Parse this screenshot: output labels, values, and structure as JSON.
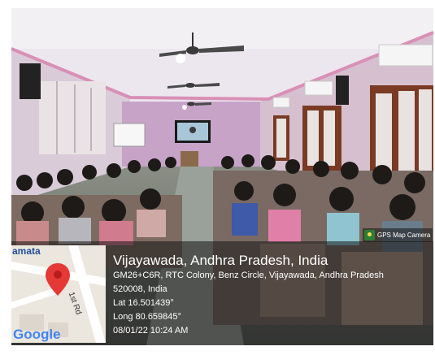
{
  "photo": {
    "description_icon": "classroom-photo"
  },
  "camera_badge": {
    "label": "GPS Map Camera",
    "icon": "gps-map-camera-icon"
  },
  "map": {
    "place_label": "amata",
    "road_label": "1st Rd",
    "brand": "Google",
    "pin_icon": "map-pin-icon"
  },
  "location": {
    "title": "Vijayawada, Andhra Pradesh, India",
    "address_line1": "GM26+C6R, RTC Colony, Benz Circle, Vijayawada, Andhra Pradesh",
    "address_line2": "520008, India",
    "lat": "Lat 16.501439°",
    "long": "Long 80.659845°",
    "datetime": "08/01/22 10:24 AM"
  }
}
